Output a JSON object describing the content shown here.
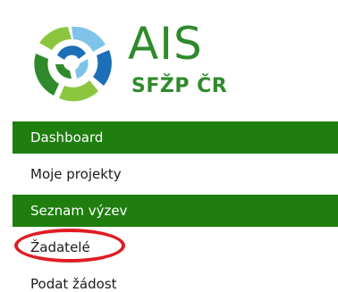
{
  "logo": {
    "name": "AIS",
    "subtitle": "SFŽP ČR",
    "colors": {
      "green": "#2f8a2c",
      "blue": "#1d6fb8",
      "light_blue": "#7fc3ea",
      "light_green": "#8cc63f"
    }
  },
  "nav": {
    "items": [
      {
        "label": "Dashboard",
        "active": true
      },
      {
        "label": "Moje projekty",
        "active": false
      },
      {
        "label": "Seznam výzev",
        "active": true
      },
      {
        "label": "Žadatelé",
        "active": false,
        "highlighted": true
      },
      {
        "label": "Podat žádost",
        "active": false
      }
    ],
    "active_color": "#1f7e0e",
    "highlight_color": "#e01c24"
  }
}
